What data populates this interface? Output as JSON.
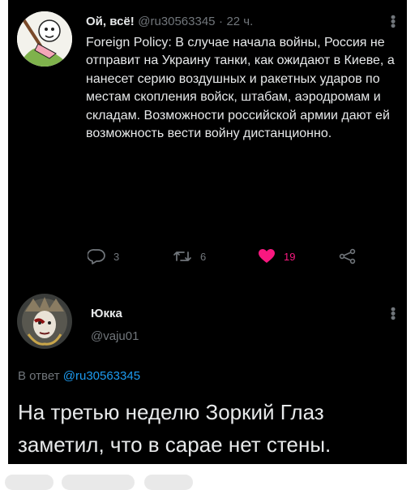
{
  "tweet": {
    "author_name": "Ой, всё!",
    "author_handle": "@ru30563345",
    "time_sep": "·",
    "time": "22 ч.",
    "text": "Foreign Policy: В случае начала войны, Россия не отправит на Украину танки, как ожидают в Киеве, а нанесет серию воздушных и ракетных ударов по местам скопления войск, штабам, аэродромам и складам. Возможности российской армии дают ей возможность вести войну дистанционно.",
    "actions": {
      "reply_count": "3",
      "retweet_count": "6",
      "like_count": "19"
    },
    "colors": {
      "like": "#f91880",
      "muted": "#71767b"
    }
  },
  "reply": {
    "author_name": "Юкка",
    "author_handle": "@vaju01",
    "reply_to_prefix": "В ответ",
    "reply_to_handle": "@ru30563345",
    "text": "На третью неделю Зоркий Глаз заметил, что в сарае нет стены.",
    "colors": {
      "link": "#1d9bf0"
    }
  },
  "icons": [
    "reply-icon",
    "retweet-icon",
    "heart-icon",
    "share-icon",
    "more-icon"
  ]
}
